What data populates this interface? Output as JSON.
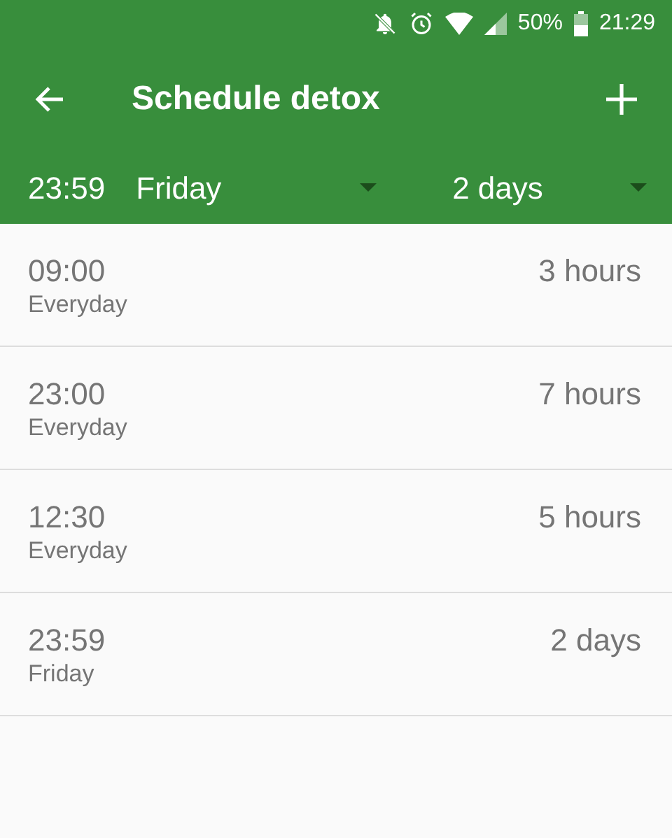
{
  "status_bar": {
    "battery": "50%",
    "time": "21:29"
  },
  "app_bar": {
    "title": "Schedule detox"
  },
  "filter": {
    "time": "23:59",
    "day": "Friday",
    "duration": "2 days"
  },
  "schedules": [
    {
      "time": "09:00",
      "days": "Everyday",
      "duration": "3 hours"
    },
    {
      "time": "23:00",
      "days": "Everyday",
      "duration": "7 hours"
    },
    {
      "time": "12:30",
      "days": "Everyday",
      "duration": "5 hours"
    },
    {
      "time": "23:59",
      "days": "Friday",
      "duration": "2 days"
    }
  ]
}
